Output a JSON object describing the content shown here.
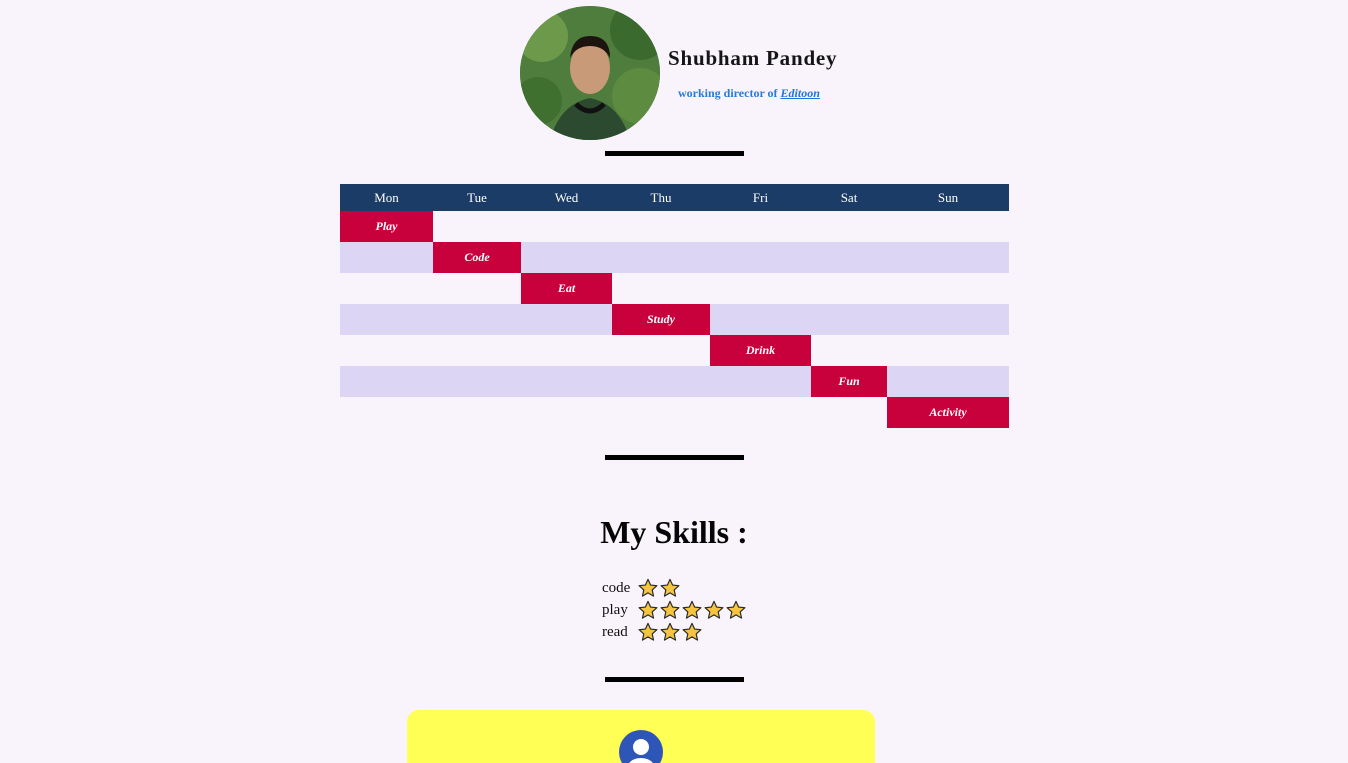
{
  "profile": {
    "name": "Shubham Pandey",
    "subtitle_prefix": "working director of",
    "brand": "Editoon",
    "brand_color": "#1f74e0"
  },
  "schedule": {
    "days": [
      "Mon",
      "Tue",
      "Wed",
      "Thu",
      "Fri",
      "Sat",
      "Sun"
    ],
    "activities": [
      "Play",
      "Code",
      "Eat",
      "Study",
      "Drink",
      "Fun",
      "Activity"
    ],
    "header_color": "#1b3c66",
    "activity_color": "#c8003b",
    "stripe_color": "#dcd6f4"
  },
  "skills": {
    "title": "My Skills :",
    "items": [
      {
        "label": "code",
        "stars": 2
      },
      {
        "label": "play",
        "stars": 5
      },
      {
        "label": "read",
        "stars": 3
      }
    ],
    "star_icon": "star-icon",
    "star_color": "#f5c542"
  },
  "card": {
    "background": "#ffff55",
    "icon": "user-avatar-icon"
  }
}
